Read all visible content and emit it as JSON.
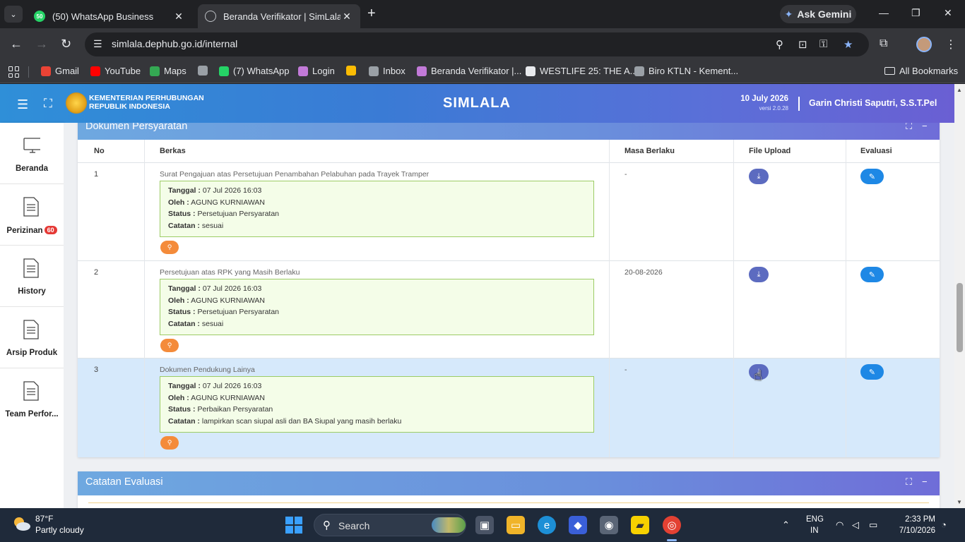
{
  "browser": {
    "tabs": [
      {
        "label": "(50) WhatsApp Business",
        "favicon_text": "50"
      },
      {
        "label": "Beranda Verifikator | SimLala"
      }
    ],
    "ask_gemini": "Ask Gemini",
    "url": "simlala.dephub.go.id/internal",
    "bookmarks": [
      {
        "label": "Gmail",
        "color": "#ea4335"
      },
      {
        "label": "YouTube",
        "color": "#ff0000"
      },
      {
        "label": "Maps",
        "color": "#34a853"
      },
      {
        "label": "",
        "color": "#9aa0a6"
      },
      {
        "label": "(7) WhatsApp",
        "color": "#25d366"
      },
      {
        "label": "Login",
        "color": "#c27ad8"
      },
      {
        "label": "",
        "color": "#fbbc04"
      },
      {
        "label": "Inbox",
        "color": "#9aa0a6"
      },
      {
        "label": "Beranda Verifikator |...",
        "color": "#c27ad8"
      },
      {
        "label": "WESTLIFE 25: THE A...",
        "color": "#e8eaed"
      },
      {
        "label": "Biro KTLN - Kement...",
        "color": "#9aa0a6"
      }
    ],
    "all_bookmarks": "All Bookmarks"
  },
  "header": {
    "ministry_line1": "KEMENTERIAN PERHUBUNGAN",
    "ministry_line2": "REPUBLIK INDONESIA",
    "title": "SIMLALA",
    "date": "10 July 2026",
    "version": "versi 2.0.28",
    "user": "Garin Christi Saputri, S.S.T.Pel"
  },
  "sidebar": {
    "items": [
      {
        "label": "Beranda",
        "icon": "monitor-icon"
      },
      {
        "label": "Perizinan",
        "badge": "60",
        "icon": "document-icon"
      },
      {
        "label": "History",
        "icon": "document-icon"
      },
      {
        "label": "Arsip Produk",
        "icon": "document-icon"
      },
      {
        "label": "Team Perfor...",
        "icon": "document-icon"
      }
    ]
  },
  "panel": {
    "title": "Dokumen Persyaratan",
    "columns": [
      "No",
      "Berkas",
      "Masa Berlaku",
      "File Upload",
      "Evaluasi"
    ],
    "labels": {
      "tanggal": "Tanggal :",
      "oleh": "Oleh :",
      "status": "Status :",
      "catatan": "Catatan :"
    },
    "rows": [
      {
        "no": "1",
        "berkas": "Surat Pengajuan atas Persetujuan Penambahan Pelabuhan pada Trayek Tramper",
        "tanggal": "07 Jul 2026 16:03",
        "oleh": "AGUNG KURNIAWAN",
        "status": "Persetujuan Persyaratan",
        "catatan": "sesuai",
        "masa_berlaku": "-"
      },
      {
        "no": "2",
        "berkas": "Persetujuan atas RPK yang Masih Berlaku",
        "tanggal": "07 Jul 2026 16:03",
        "oleh": "AGUNG KURNIAWAN",
        "status": "Persetujuan Persyaratan",
        "catatan": "sesuai",
        "masa_berlaku": "20-08-2026"
      },
      {
        "no": "3",
        "berkas": "Dokumen Pendukung Lainya",
        "tanggal": "07 Jul 2026 16:03",
        "oleh": "AGUNG KURNIAWAN",
        "status": "Perbaikan Persyaratan",
        "catatan": "lampirkan scan siupal asli dan BA Siupal yang masih berlaku",
        "masa_berlaku": "-"
      }
    ]
  },
  "panel2": {
    "title": "Catatan Evaluasi"
  },
  "taskbar": {
    "temp": "87°F",
    "weather": "Partly cloudy",
    "search": "Search",
    "lang1": "ENG",
    "lang2": "IN",
    "time": "2:33 PM",
    "date": "7/10/2026"
  }
}
